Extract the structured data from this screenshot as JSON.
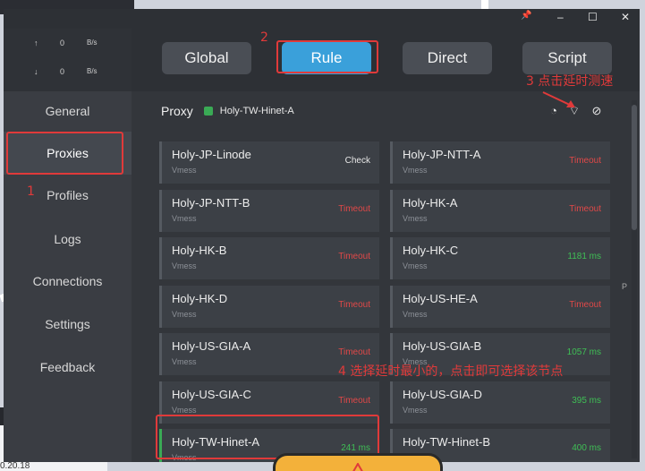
{
  "titlebar": {
    "pin": "📌",
    "minimize": "–",
    "maximize": "☐",
    "close": "✕"
  },
  "traffic": {
    "up_arrow": "↑",
    "up_value": "0",
    "up_unit": "B/s",
    "down_arrow": "↓",
    "down_value": "0",
    "down_unit": "B/s"
  },
  "sidebar": {
    "items": [
      {
        "label": "General"
      },
      {
        "label": "Proxies"
      },
      {
        "label": "Profiles"
      },
      {
        "label": "Logs"
      },
      {
        "label": "Connections"
      },
      {
        "label": "Settings"
      },
      {
        "label": "Feedback"
      }
    ]
  },
  "modes": [
    "Global",
    "Rule",
    "Direct",
    "Script"
  ],
  "active_mode": "Rule",
  "group": {
    "name": "Proxy",
    "selected": "Holy-TW-Hinet-A",
    "icons": [
      "speedometer-icon",
      "wifi-icon",
      "eye-off-icon"
    ]
  },
  "colors": {
    "timeout": "#e04848",
    "ok": "#3fbf55",
    "accent": "#3aa0da",
    "annotation": "#e03a3a"
  },
  "proxies": [
    {
      "name": "Holy-JP-Linode",
      "type": "Vmess",
      "latency": "Check"
    },
    {
      "name": "Holy-JP-NTT-A",
      "type": "Vmess",
      "latency": "Timeout"
    },
    {
      "name": "Holy-JP-NTT-B",
      "type": "Vmess",
      "latency": "Timeout"
    },
    {
      "name": "Holy-HK-A",
      "type": "Vmess",
      "latency": "Timeout"
    },
    {
      "name": "Holy-HK-B",
      "type": "Vmess",
      "latency": "Timeout"
    },
    {
      "name": "Holy-HK-C",
      "type": "Vmess",
      "latency": "1181 ms"
    },
    {
      "name": "Holy-HK-D",
      "type": "Vmess",
      "latency": "Timeout"
    },
    {
      "name": "Holy-US-HE-A",
      "type": "Vmess",
      "latency": "Timeout"
    },
    {
      "name": "Holy-US-GIA-A",
      "type": "Vmess",
      "latency": "Timeout"
    },
    {
      "name": "Holy-US-GIA-B",
      "type": "Vmess",
      "latency": "1057 ms"
    },
    {
      "name": "Holy-US-GIA-C",
      "type": "Vmess",
      "latency": "Timeout"
    },
    {
      "name": "Holy-US-GIA-D",
      "type": "Vmess",
      "latency": "395 ms"
    },
    {
      "name": "Holy-TW-Hinet-A",
      "type": "Vmess",
      "latency": "241 ms"
    },
    {
      "name": "Holy-TW-Hinet-B",
      "type": "Vmess",
      "latency": "400 ms"
    }
  ],
  "annotations": {
    "n1": "1",
    "n2": "2",
    "n3": "3 点击延时测速",
    "n4": "4 选择延时最小的，点击即可选择该节点"
  },
  "scroll_marker": "P",
  "background_window": {
    "minimize": "–",
    "maximize": "☐",
    "close": "✕",
    "text": "0.20.18"
  }
}
